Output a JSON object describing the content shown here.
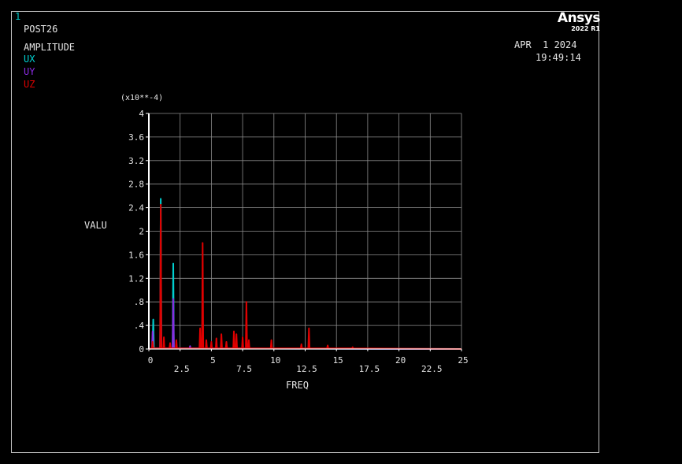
{
  "window_number": "1",
  "header": {
    "program": "POST26",
    "quantity": "AMPLITUDE",
    "legend": [
      {
        "label": "UX",
        "color": "#00d0d0"
      },
      {
        "label": "UY",
        "color": "#8a2be2"
      },
      {
        "label": "UZ",
        "color": "#e00000"
      }
    ]
  },
  "datetime": {
    "date": "APR  1 2024",
    "time": "19:49:14"
  },
  "logo": {
    "brand": "Ansys",
    "version": "2022 R1"
  },
  "chart_data": {
    "type": "line",
    "xlabel": "FREQ",
    "ylabel": "VALU",
    "y_multiplier": "(x10**-4)",
    "xlim": [
      0,
      25
    ],
    "ylim": [
      0,
      4
    ],
    "x_ticks": [
      0,
      2.5,
      5,
      7.5,
      10,
      12.5,
      15,
      17.5,
      20,
      22.5,
      25
    ],
    "x_tick_labels": [
      "0",
      "2.5",
      "5",
      "7.5",
      "10",
      "12.5",
      "15",
      "17.5",
      "20",
      "22.5",
      "25"
    ],
    "y_ticks": [
      0,
      0.4,
      0.8,
      1.2,
      1.6,
      2,
      2.4,
      2.8,
      3.2,
      3.6,
      4
    ],
    "y_tick_labels": [
      "0",
      ".4",
      ".8",
      "1.2",
      "1.6",
      "2",
      "2.4",
      "2.8",
      "3.2",
      "3.6",
      "4"
    ],
    "grid": true,
    "series": [
      {
        "name": "UX",
        "color": "#00d0d0",
        "peaks": [
          [
            0.35,
            0.5
          ],
          [
            0.95,
            2.55
          ],
          [
            1.95,
            1.45
          ],
          [
            4.3,
            0.1
          ]
        ]
      },
      {
        "name": "UY",
        "color": "#8a2be2",
        "peaks": [
          [
            0.3,
            0.3
          ],
          [
            0.95,
            1.3
          ],
          [
            1.95,
            0.85
          ],
          [
            3.3,
            0.05
          ],
          [
            4.3,
            0.06
          ]
        ]
      },
      {
        "name": "UZ",
        "color": "#e00000",
        "peaks": [
          [
            0.3,
            0.12
          ],
          [
            0.95,
            2.45
          ],
          [
            1.2,
            0.2
          ],
          [
            1.7,
            0.1
          ],
          [
            2.2,
            0.15
          ],
          [
            4.1,
            0.35
          ],
          [
            4.3,
            1.8
          ],
          [
            4.6,
            0.15
          ],
          [
            5.0,
            0.12
          ],
          [
            5.4,
            0.18
          ],
          [
            5.8,
            0.25
          ],
          [
            6.2,
            0.12
          ],
          [
            6.8,
            0.3
          ],
          [
            7.0,
            0.25
          ],
          [
            7.5,
            0.2
          ],
          [
            7.8,
            0.8
          ],
          [
            8.0,
            0.15
          ],
          [
            9.8,
            0.15
          ],
          [
            12.2,
            0.08
          ],
          [
            12.8,
            0.35
          ],
          [
            14.3,
            0.06
          ],
          [
            16.3,
            0.03
          ]
        ]
      }
    ]
  }
}
